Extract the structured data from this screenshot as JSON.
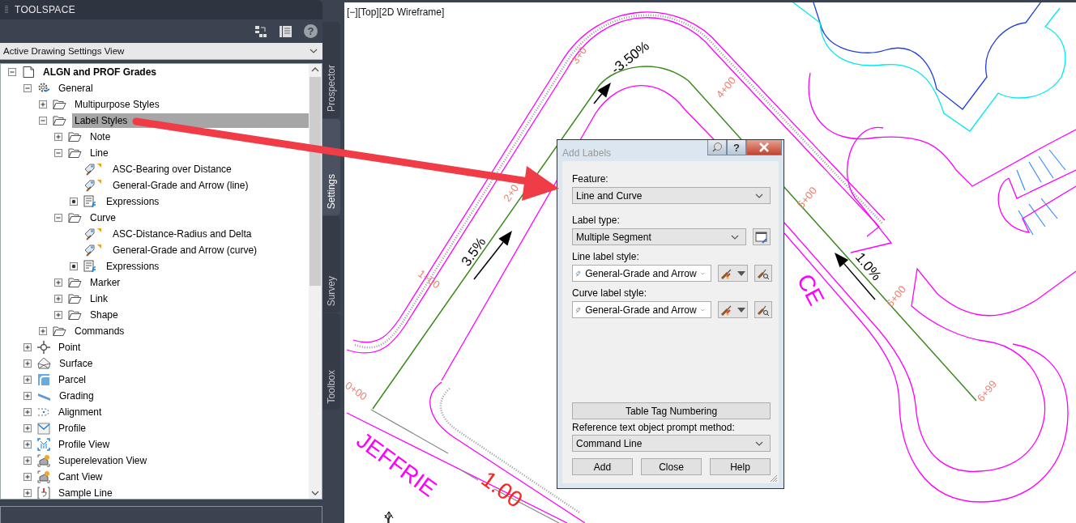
{
  "toolspace": {
    "title": "TOOLSPACE",
    "help_glyph": "?",
    "view_dropdown": "Active Drawing Settings View",
    "tree": [
      {
        "label": "ALGN and PROF Grades",
        "kind": "drawing",
        "expanded": true,
        "selected": false,
        "children": [
          {
            "label": "General",
            "kind": "gear",
            "expanded": true,
            "selected": false,
            "children": [
              {
                "label": "Multipurpose Styles",
                "kind": "folder",
                "expanded": false,
                "selected": false
              },
              {
                "label": "Label Styles",
                "kind": "folder",
                "expanded": true,
                "selected": true,
                "children": [
                  {
                    "label": "Note",
                    "kind": "folder",
                    "expanded": false,
                    "selected": false
                  },
                  {
                    "label": "Line",
                    "kind": "folder",
                    "expanded": true,
                    "selected": false,
                    "children": [
                      {
                        "label": "ASC-Bearing over Distance",
                        "kind": "style",
                        "selected": false
                      },
                      {
                        "label": "General-Grade and Arrow (line)",
                        "kind": "style",
                        "selected": false
                      },
                      {
                        "label": "Expressions",
                        "kind": "expressions",
                        "selected": false
                      }
                    ]
                  },
                  {
                    "label": "Curve",
                    "kind": "folder",
                    "expanded": true,
                    "selected": false,
                    "children": [
                      {
                        "label": "ASC-Distance-Radius and Delta",
                        "kind": "style",
                        "selected": false
                      },
                      {
                        "label": "General-Grade and Arrow (curve)",
                        "kind": "style",
                        "selected": false
                      },
                      {
                        "label": "Expressions",
                        "kind": "expressions",
                        "selected": false
                      }
                    ]
                  },
                  {
                    "label": "Marker",
                    "kind": "folder",
                    "expanded": false,
                    "selected": false
                  },
                  {
                    "label": "Link",
                    "kind": "folder",
                    "expanded": false,
                    "selected": false
                  },
                  {
                    "label": "Shape",
                    "kind": "folder",
                    "expanded": false,
                    "selected": false
                  }
                ]
              },
              {
                "label": "Commands",
                "kind": "folder",
                "expanded": false,
                "selected": false
              }
            ]
          },
          {
            "label": "Point",
            "kind": "point",
            "expanded": false,
            "selected": false
          },
          {
            "label": "Surface",
            "kind": "surface",
            "expanded": false,
            "selected": false
          },
          {
            "label": "Parcel",
            "kind": "parcel",
            "expanded": false,
            "selected": false
          },
          {
            "label": "Grading",
            "kind": "grading",
            "expanded": false,
            "selected": false
          },
          {
            "label": "Alignment",
            "kind": "alignment",
            "expanded": false,
            "selected": false
          },
          {
            "label": "Profile",
            "kind": "profile",
            "expanded": false,
            "selected": false
          },
          {
            "label": "Profile View",
            "kind": "profile_view",
            "expanded": false,
            "selected": false
          },
          {
            "label": "Superelevation View",
            "kind": "superelevation",
            "expanded": false,
            "selected": false
          },
          {
            "label": "Cant View",
            "kind": "superelevation",
            "expanded": false,
            "selected": false
          },
          {
            "label": "Sample Line",
            "kind": "sample_line",
            "expanded": false,
            "selected": false
          }
        ]
      }
    ]
  },
  "side_tabs": [
    {
      "label": "Prospector",
      "selected": false
    },
    {
      "label": "Settings",
      "selected": true
    },
    {
      "label": "Survey",
      "selected": false
    },
    {
      "label": "Toolbox",
      "selected": false
    }
  ],
  "viewport": {
    "label": "[−][Top][2D Wireframe]",
    "grades": [
      "-3.50%",
      "3.5%",
      "1.0%"
    ],
    "stations": [
      "3+0",
      "2+0",
      "1+00",
      "0+00",
      "4+00",
      "5+00",
      "6+00",
      "6+99"
    ],
    "street_names": [
      "JEFFRIE",
      "CE"
    ],
    "dimension": "1.00",
    "axis_label": "Y"
  },
  "dialog": {
    "title": "Add Labels",
    "help_glyph": "?",
    "feature": {
      "label": "Feature:",
      "value": "Line and Curve"
    },
    "label_type": {
      "label": "Label type:",
      "value": "Multiple Segment"
    },
    "line_label_style": {
      "label": "Line label style:",
      "value": "General-Grade and Arrow"
    },
    "curve_label_style": {
      "label": "Curve label style:",
      "value": "General-Grade and Arrow"
    },
    "table_tag_button": "Table Tag Numbering",
    "prompt_method": {
      "label": "Reference text object prompt method:",
      "value": "Command Line"
    },
    "buttons": [
      "Add",
      "Close",
      "Help"
    ]
  }
}
